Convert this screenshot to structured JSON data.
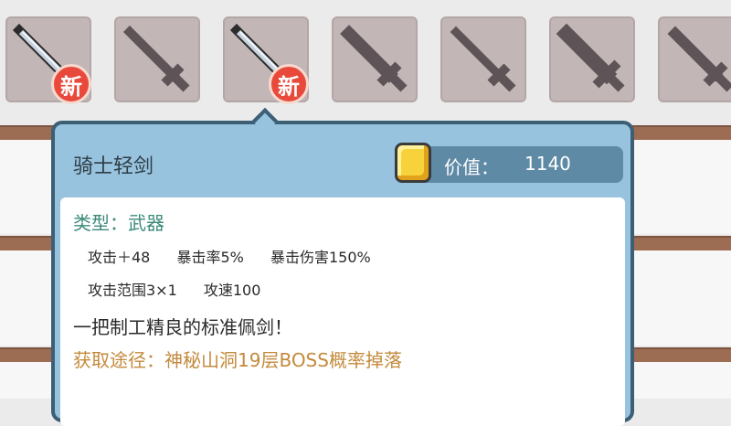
{
  "inventory": {
    "slots": [
      {
        "icon": "sword-icon",
        "state": "unlocked",
        "badge": "新"
      },
      {
        "icon": "sword-silhouette-icon",
        "state": "locked",
        "badge": ""
      },
      {
        "icon": "sword-icon",
        "state": "unlocked",
        "badge": "新"
      },
      {
        "icon": "sword-silhouette-icon",
        "state": "locked",
        "badge": ""
      },
      {
        "icon": "sword-silhouette-icon",
        "state": "locked",
        "badge": ""
      },
      {
        "icon": "sword-silhouette-icon",
        "state": "locked",
        "badge": ""
      },
      {
        "icon": "sword-silhouette-icon",
        "state": "locked",
        "badge": ""
      }
    ]
  },
  "tooltip": {
    "name": "骑士轻剑",
    "price_label": "价值：",
    "price_value": "1140",
    "type": "类型：武器",
    "stats_row1": [
      "攻击＋48",
      "暴击率5%",
      "暴击伤害150%"
    ],
    "stats_row2": [
      "攻击范围3×1",
      "攻速100"
    ],
    "description": "一把制工精良的标准佩剑！",
    "source": "获取途径：神秘山洞19层BOSS概率掉落"
  },
  "colors": {
    "background": "#ebebeb",
    "shelf": "#9c6d52",
    "slot": "#c3b6b6",
    "badge": "#e8493b",
    "tooltip_frame": "#97c3df",
    "tooltip_border": "#3c5f76",
    "type_text": "#3c8a7a",
    "source_text": "#c48a3c"
  }
}
